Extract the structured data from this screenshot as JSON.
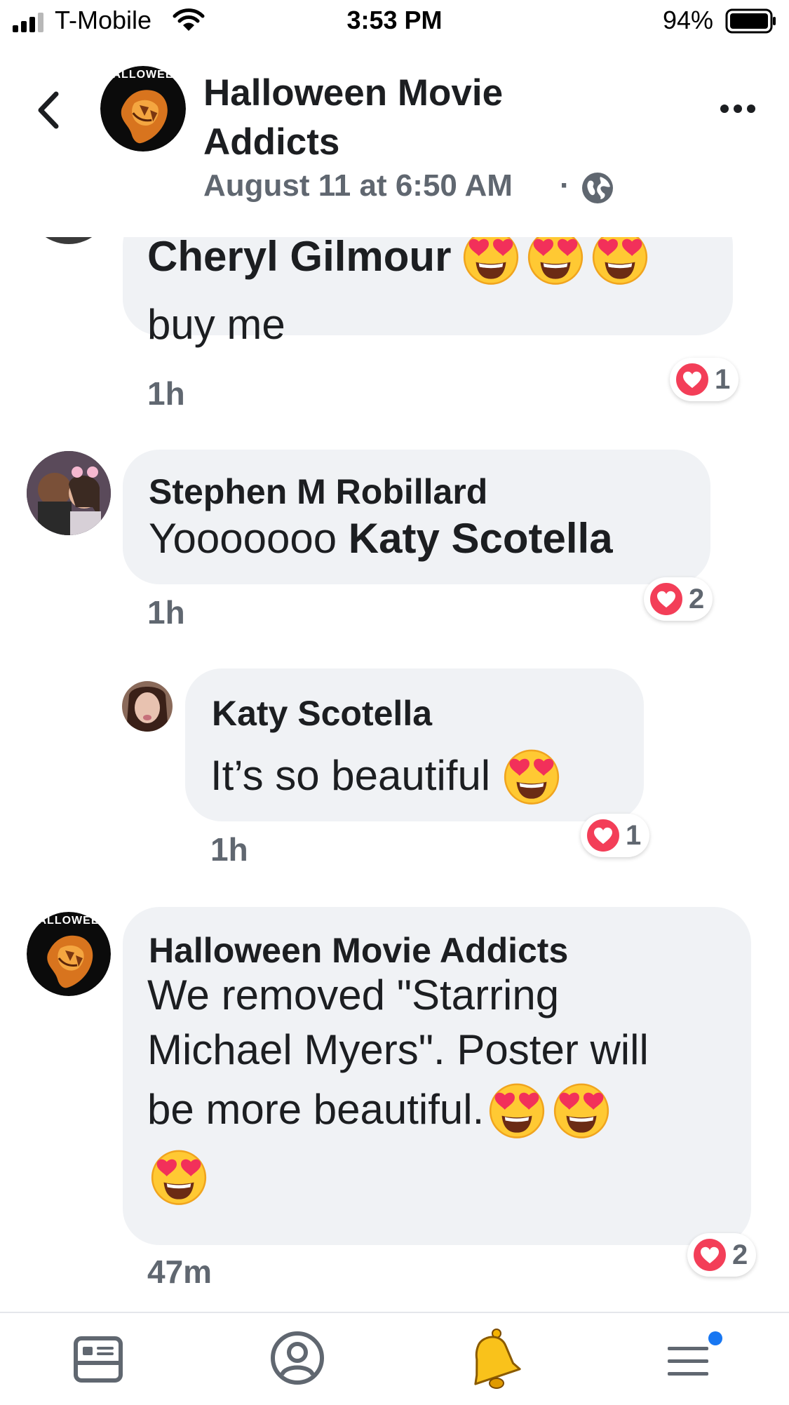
{
  "status_bar": {
    "carrier": "T-Mobile",
    "time": "3:53 PM",
    "battery": "94%"
  },
  "header": {
    "group_name": "Halloween Movie Addicts",
    "avatar_text": "HALLOWEEN",
    "post_time": "August 11 at 6:50 AM",
    "separator": "·"
  },
  "comments": [
    {
      "name": "Cheryl Gilmour",
      "text": "buy me",
      "time": "1h",
      "reactions": "1"
    },
    {
      "name": "Stephen M Robillard",
      "text_prefix": "Yooooooo ",
      "mention": "Katy Scotella",
      "time": "1h",
      "reactions": "2"
    },
    {
      "name": "Katy Scotella",
      "text": "It’s so beautiful",
      "time": "1h",
      "reactions": "1"
    },
    {
      "name": "Halloween Movie Addicts",
      "avatar_text": "HALLOWEEN",
      "line1": "We removed \"Starring",
      "line2": "Michael Myers\". Poster will",
      "line3": "be more beautiful.",
      "time": "47m",
      "reactions": "2"
    }
  ],
  "colors": {
    "bubble": "#f0f2f5",
    "heart": "#f33e58",
    "badge": "#1877f2",
    "muted_text": "#606770"
  },
  "icons": [
    "signal-icon",
    "wifi-icon",
    "battery-icon",
    "back-icon",
    "more-icon",
    "globe-icon",
    "heart-eyes-emoji",
    "heart-reaction-icon",
    "news-feed-icon",
    "profile-icon",
    "bell-icon",
    "menu-icon"
  ]
}
